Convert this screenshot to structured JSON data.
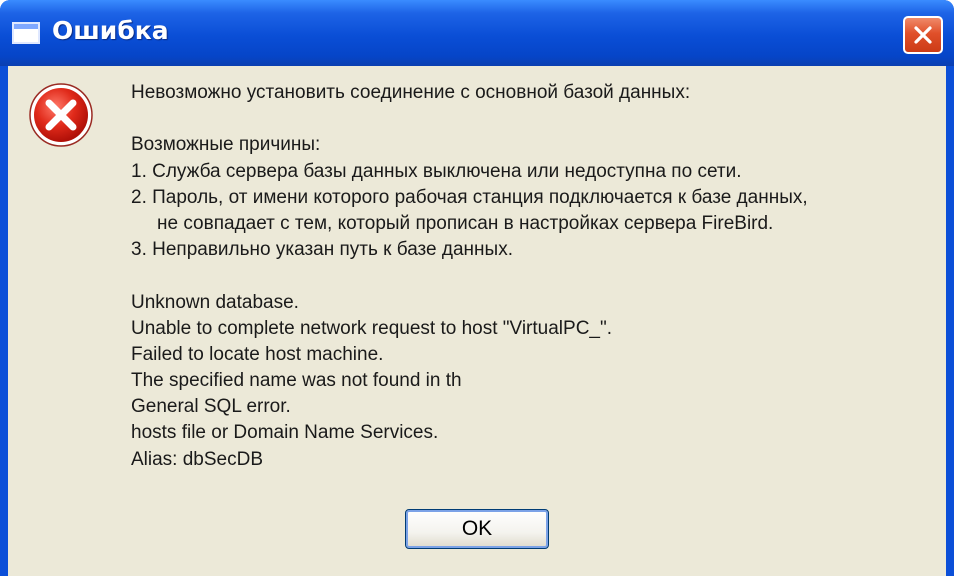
{
  "window": {
    "title": "Ошибка",
    "accent_color": "#0a4ed6",
    "close_icon": "close-x-icon"
  },
  "dialog": {
    "icon": "error-icon",
    "icon_color": "#d42020",
    "heading": "Невозможно установить соединение с основной базой данных:",
    "causes_title": "Возможные причины:",
    "causes": [
      "1. Служба сервера базы данных выключена или недоступна по сети.",
      "2. Пароль, от имени которого рабочая станция подключается к базе данных,",
      "не совпадает с тем, который прописан в настройках сервера FireBird.",
      "3. Неправильно указан путь к базе данных."
    ],
    "details": [
      "Unknown database.",
      "Unable to complete network request to host \"VirtualPC_\".",
      "Failed to locate host machine.",
      "The specified name was not found in th",
      "General SQL error.",
      "hosts file or Domain Name Services.",
      "Alias: dbSecDB"
    ],
    "ok_label": "OK"
  }
}
